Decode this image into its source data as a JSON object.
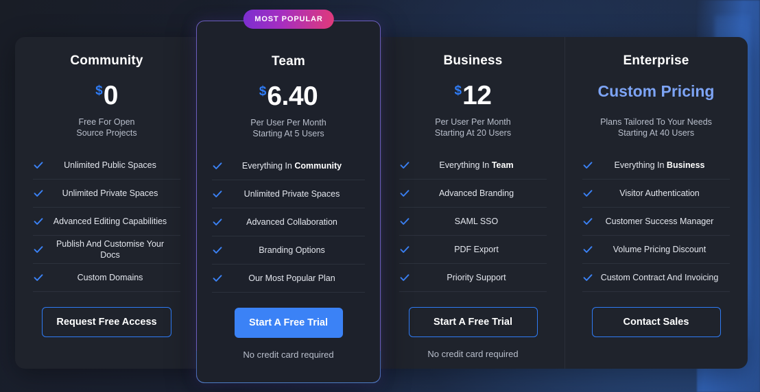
{
  "colors": {
    "accent_blue": "#3b82f6",
    "currency_blue": "#2f7cf6",
    "custom_pricing_blue": "#7da4f5",
    "featured_border": "#6d5fbe",
    "badge_gradient_from": "#7b2fd0",
    "badge_gradient_to": "#e03a7a",
    "card_bg": "#1f232c",
    "featured_bg": "#1d212b"
  },
  "badge": {
    "label": "MOST POPULAR"
  },
  "plans": [
    {
      "name": "Community",
      "currency": "$",
      "amount": "0",
      "custom_price": "",
      "sub_line1": "Free For Open",
      "sub_line2": "Source Projects",
      "features": [
        {
          "text": "Unlimited Public Spaces",
          "bold": ""
        },
        {
          "text": "Unlimited Private Spaces",
          "bold": ""
        },
        {
          "text": "Advanced Editing Capabilities",
          "bold": ""
        },
        {
          "text": "Publish And Customise Your Docs",
          "bold": ""
        },
        {
          "text": "Custom Domains",
          "bold": ""
        }
      ],
      "cta_label": "Request Free Access",
      "cta_style": "outline",
      "note": ""
    },
    {
      "name": "Team",
      "currency": "$",
      "amount": "6.40",
      "custom_price": "",
      "sub_line1": "Per User Per Month",
      "sub_line2": "Starting At 5 Users",
      "features": [
        {
          "text": "Everything In ",
          "bold": "Community"
        },
        {
          "text": "Unlimited Private Spaces",
          "bold": ""
        },
        {
          "text": "Advanced Collaboration",
          "bold": ""
        },
        {
          "text": "Branding Options",
          "bold": ""
        },
        {
          "text": "Our Most Popular Plan",
          "bold": ""
        }
      ],
      "cta_label": "Start A Free Trial",
      "cta_style": "solid",
      "note": "No credit card required"
    },
    {
      "name": "Business",
      "currency": "$",
      "amount": "12",
      "custom_price": "",
      "sub_line1": "Per User Per Month",
      "sub_line2": "Starting At 20 Users",
      "features": [
        {
          "text": "Everything In ",
          "bold": "Team"
        },
        {
          "text": "Advanced Branding",
          "bold": ""
        },
        {
          "text": "SAML SSO",
          "bold": ""
        },
        {
          "text": "PDF Export",
          "bold": ""
        },
        {
          "text": "Priority Support",
          "bold": ""
        }
      ],
      "cta_label": "Start A Free Trial",
      "cta_style": "outline",
      "note": "No credit card required"
    },
    {
      "name": "Enterprise",
      "currency": "",
      "amount": "",
      "custom_price": "Custom Pricing",
      "sub_line1": "Plans Tailored To Your Needs",
      "sub_line2": "Starting At 40 Users",
      "features": [
        {
          "text": "Everything In ",
          "bold": "Business"
        },
        {
          "text": "Visitor Authentication",
          "bold": ""
        },
        {
          "text": "Customer Success Manager",
          "bold": ""
        },
        {
          "text": "Volume Pricing Discount",
          "bold": ""
        },
        {
          "text": "Custom Contract And Invoicing",
          "bold": ""
        }
      ],
      "cta_label": "Contact Sales",
      "cta_style": "outline",
      "note": ""
    }
  ]
}
